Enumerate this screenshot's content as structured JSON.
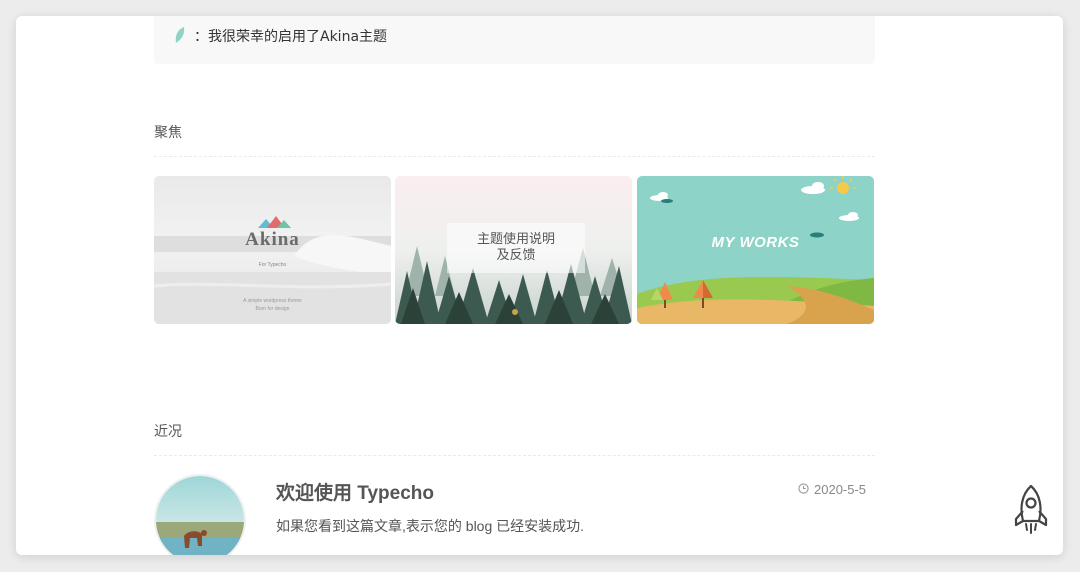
{
  "notice": {
    "text": "：我很荣幸的启用了Akina主题",
    "icon": "leaf-icon"
  },
  "focus_section": {
    "title": "聚焦",
    "cards": [
      {
        "brand": "Akina",
        "subtitle": "For Typecho",
        "tagline_1": "A simple wordpress theme",
        "tagline_2": "Born for design"
      },
      {
        "label_line1": "主题使用说明",
        "label_line2": "及反馈"
      },
      {
        "label": "MY WORKS"
      }
    ]
  },
  "recent_section": {
    "title": "近况",
    "posts": [
      {
        "title": "欢迎使用 Typecho",
        "date": "2020-5-5",
        "excerpt": "如果您看到这篇文章,表示您的 blog 已经安装成功."
      }
    ]
  },
  "colors": {
    "leaf": "#8fd3c4",
    "accent_teal": "#8dd3c7"
  },
  "back_to_top": {
    "icon": "rocket-icon"
  }
}
